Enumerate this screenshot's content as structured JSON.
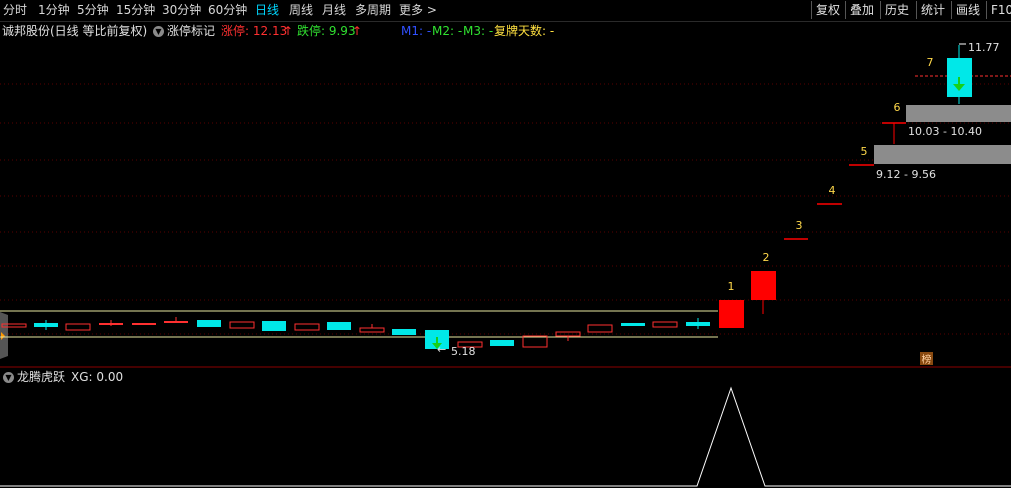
{
  "toolbar": {
    "periods": [
      "分时",
      "1分钟",
      "5分钟",
      "15分钟",
      "30分钟",
      "60分钟",
      "日线",
      "周线",
      "月线",
      "多周期",
      "更多 >"
    ],
    "active_period": "日线",
    "right_buttons": [
      "复权",
      "叠加",
      "历史",
      "统计",
      "画线",
      "F10"
    ]
  },
  "info": {
    "stock_title": "诚邦股份(日线 等比前复权)",
    "indicator_name": "涨停标记",
    "limit_up_label": "涨停: 12.13",
    "limit_down_label": "跌停: 9.93",
    "m1": "M1: -",
    "m2": "M2: -",
    "m3": "M3: -",
    "suspend_days": "复牌天数: -"
  },
  "main_chart": {
    "annotations": {
      "high_price": "11.77",
      "low_price": "5.18",
      "gap_upper": "10.03 - 10.40",
      "gap_lower": "9.12 - 9.56",
      "board_count_labels": [
        "1",
        "2",
        "3",
        "4",
        "5",
        "6",
        "7"
      ],
      "tag_badge": "榜"
    },
    "colors": {
      "up": "#ff2222",
      "down": "#00e8e8",
      "limit_up": "#ff0000",
      "gap_zone": "#8c8c8c",
      "band_line": "#e8e8a0",
      "count_label": "#ffd84a",
      "grid": "#8b0000"
    }
  },
  "lower_panel": {
    "title": "龙腾虎跃",
    "xg_label": "XG: 0.00"
  }
}
